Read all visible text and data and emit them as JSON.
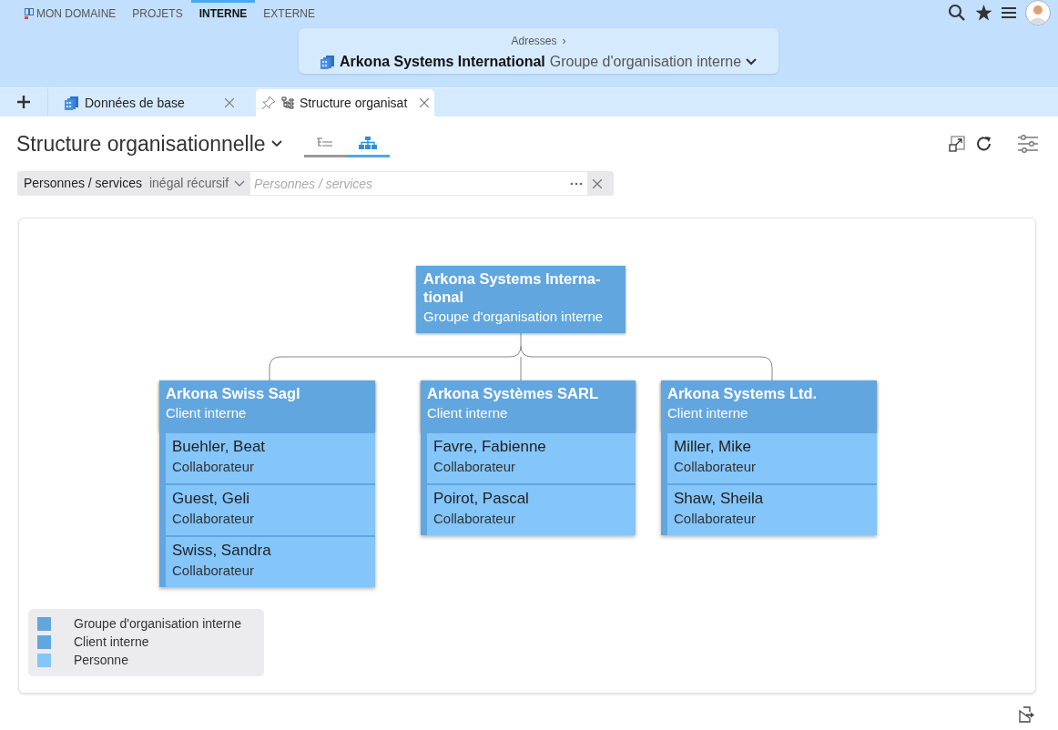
{
  "top_nav": [
    {
      "label": "MON DOMAINE",
      "selected": false
    },
    {
      "label": "PROJETS",
      "selected": false
    },
    {
      "label": "INTERNE",
      "selected": true
    },
    {
      "label": "EXTERNE",
      "selected": false
    }
  ],
  "breadcrumb": {
    "parent": "Adresses",
    "separator": "›",
    "title": "Arkona Systems International",
    "subtitle": "Groupe d'organisation interne"
  },
  "doc_tabs": [
    {
      "label": "Données de base",
      "selected": false,
      "pinned": false
    },
    {
      "label": "Structure organisat",
      "selected": true,
      "pinned": true
    }
  ],
  "view": {
    "title": "Structure organisationnelle",
    "modes": [
      {
        "kind": "list",
        "selected": false
      },
      {
        "kind": "chart",
        "selected": true
      }
    ]
  },
  "filter": {
    "field": "Personnes / services",
    "operator": "inégal récursif",
    "placeholder": "Personnes / services"
  },
  "org_chart": {
    "root": {
      "kind": "group",
      "name": "Arkona Systems Interna-tional",
      "type": "Groupe d'organisation interne"
    },
    "children": [
      {
        "kind": "client",
        "name": "Arkona Swiss Sagl",
        "type": "Client interne",
        "people": [
          {
            "name": "Buehler, Beat",
            "role": "Collaborateur"
          },
          {
            "name": "Guest, Geli",
            "role": "Collaborateur"
          },
          {
            "name": "Swiss, Sandra",
            "role": "Collaborateur"
          }
        ]
      },
      {
        "kind": "client",
        "name": "Arkona Systèmes SARL",
        "type": "Client interne",
        "people": [
          {
            "name": "Favre, Fabienne",
            "role": "Collaborateur"
          },
          {
            "name": "Poirot, Pascal",
            "role": "Collaborateur"
          }
        ]
      },
      {
        "kind": "client",
        "name": "Arkona Systems Ltd.",
        "type": "Client interne",
        "people": [
          {
            "name": "Miller, Mike",
            "role": "Collaborateur"
          },
          {
            "name": "Shaw, Sheila",
            "role": "Collaborateur"
          }
        ]
      }
    ]
  },
  "legend": [
    {
      "label": "Groupe d'organisation interne",
      "color": "#62a6df"
    },
    {
      "label": "Client interne",
      "color": "#62a6df"
    },
    {
      "label": "Personne",
      "color": "#84c5fa"
    }
  ]
}
